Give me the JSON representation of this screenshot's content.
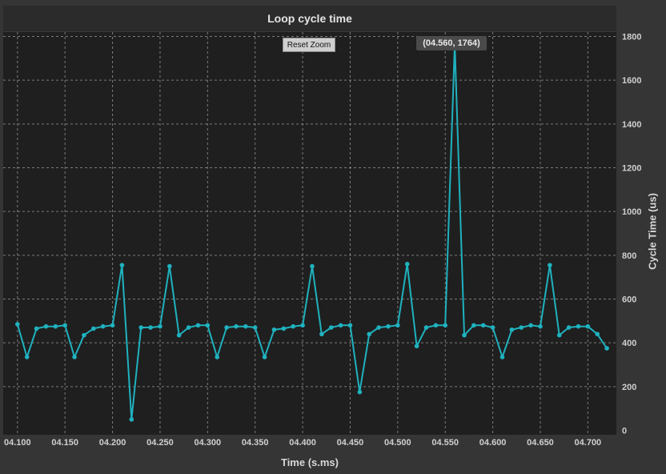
{
  "chart_data": {
    "type": "line",
    "title": "Loop cycle time",
    "xlabel": "Time (s.ms)",
    "ylabel": "Cycle Time (us)",
    "xlim": [
      4.085,
      4.73
    ],
    "ylim": [
      -20,
      1820
    ],
    "x_ticks": [
      "04.100",
      "04.150",
      "04.200",
      "04.250",
      "04.300",
      "04.350",
      "04.400",
      "04.450",
      "04.500",
      "04.550",
      "04.600",
      "04.650",
      "04.700"
    ],
    "x_tick_values": [
      4.1,
      4.15,
      4.2,
      4.25,
      4.3,
      4.35,
      4.4,
      4.45,
      4.5,
      4.55,
      4.6,
      4.65,
      4.7
    ],
    "y_ticks": [
      0,
      200,
      400,
      600,
      800,
      1000,
      1200,
      1400,
      1600,
      1800
    ],
    "grid": true,
    "color": "#1fb2bf",
    "series": [
      {
        "x": [
          4.1,
          4.11,
          4.12,
          4.13,
          4.14,
          4.15,
          4.16,
          4.17,
          4.18,
          4.19,
          4.2,
          4.21,
          4.22,
          4.23,
          4.24,
          4.25,
          4.26,
          4.27,
          4.28,
          4.29,
          4.3,
          4.31,
          4.32,
          4.33,
          4.34,
          4.35,
          4.36,
          4.37,
          4.38,
          4.39,
          4.4,
          4.41,
          4.42,
          4.43,
          4.44,
          4.45,
          4.46,
          4.47,
          4.48,
          4.49,
          4.5,
          4.51,
          4.52,
          4.53,
          4.54,
          4.55,
          4.56,
          4.57,
          4.58,
          4.59,
          4.6,
          4.61,
          4.62,
          4.63,
          4.64,
          4.65,
          4.66,
          4.67,
          4.68,
          4.69,
          4.7,
          4.71,
          4.72
        ],
        "values": [
          485,
          335,
          465,
          475,
          475,
          480,
          335,
          435,
          465,
          475,
          480,
          755,
          50,
          470,
          470,
          475,
          750,
          435,
          470,
          480,
          480,
          335,
          470,
          475,
          475,
          470,
          335,
          460,
          465,
          475,
          480,
          750,
          440,
          470,
          480,
          480,
          175,
          440,
          470,
          475,
          480,
          760,
          385,
          470,
          480,
          480,
          1764,
          435,
          480,
          480,
          470,
          335,
          460,
          470,
          480,
          475,
          755,
          435,
          470,
          475,
          475,
          440,
          375
        ]
      }
    ],
    "highlight_point": {
      "x": 4.56,
      "y": 1764
    }
  },
  "ui": {
    "title": "Loop cycle time",
    "reset_zoom_label": "Reset Zoom",
    "tooltip_text": "(04.560, 1764)",
    "xlabel": "Time (s.ms)",
    "ylabel": "Cycle Time (us)"
  }
}
